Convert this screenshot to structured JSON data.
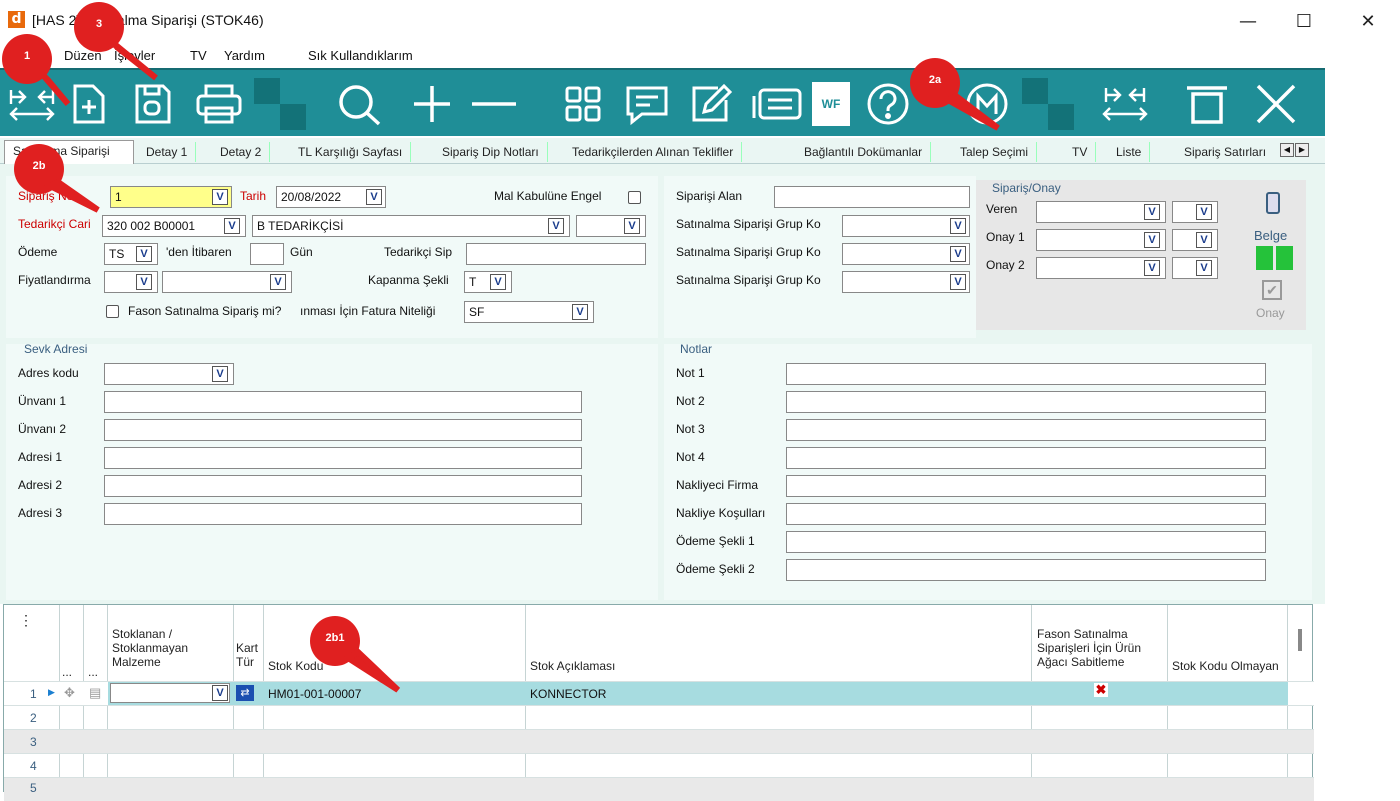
{
  "window": {
    "title": "[HAS         2] Satınalma Siparişi (STOK46)",
    "minimize": "—",
    "maximize": "☐",
    "close": "✕"
  },
  "menu": [
    "Düzen",
    "İşlevler",
    "TV",
    "Yardım",
    "Sık Kullandıklarım"
  ],
  "toolbar": {
    "wf_label": "WF",
    "icons": [
      "first-last-arrows-icon",
      "new-document-icon",
      "save-icon",
      "print-icon",
      "search-icon",
      "plus-icon",
      "minus-icon",
      "grid-icon",
      "comment-icon",
      "edit-icon",
      "list-icon",
      "wf-icon",
      "help-icon",
      "info-m-icon",
      "expand-icon",
      "delete-icon",
      "close-icon"
    ]
  },
  "tabs": [
    "Satınalma Siparişi",
    "Detay 1",
    "Detay 2",
    "TL Karşılığı Sayfası",
    "Sipariş Dip Notları",
    "Tedarikçilerden Alınan Teklifler",
    "Bağlantılı Dokümanlar",
    "Talep Seçimi",
    "TV",
    "Liste",
    "Sipariş Satırları"
  ],
  "form": {
    "siparis_no_label": "Sipariş No",
    "siparis_no_value": "1",
    "tarih_label": "Tarih",
    "tarih_value": "20/08/2022",
    "mal_kabul_label": "Mal Kabulüne Engel",
    "tedarikci_label": "Tedarikçi Cari",
    "tedarikci_code": "320 002 B00001",
    "tedarikci_name": "B TEDARİKÇİSİ",
    "odeme_label": "Ödeme",
    "odeme_value": "TS",
    "den_itibaren": "'den İtibaren",
    "gun": "Gün",
    "tedarikci_sip": "Tedarikçi Sip",
    "fiyatlandirma": "Fiyatlandırma",
    "kapanma_label": "Kapanma Şekli",
    "kapanma_value": "T",
    "fason_label": "Fason Satınalma Sipariş mi?",
    "fatura_niteligi_label": "ınması İçin Fatura Niteliği",
    "fatura_niteligi_value": "SF",
    "siparisi_alan": "Siparişi Alan",
    "grup_ko_1": "Satınalma Siparişi Grup Ko",
    "grup_ko_2": "Satınalma Siparişi Grup Ko",
    "grup_ko_3": "Satınalma Siparişi Grup Ko"
  },
  "onay": {
    "group_title": "Sipariş/Onay",
    "veren": "Veren",
    "onay1": "Onay 1",
    "onay2": "Onay 2",
    "belge": "Belge",
    "onay_btn": "Onay"
  },
  "sevk": {
    "group_title": "Sevk Adresi",
    "fields": [
      "Adres kodu",
      "Ünvanı 1",
      "Ünvanı 2",
      "Adresi 1",
      "Adresi 2",
      "Adresi 3"
    ]
  },
  "notlar": {
    "group_title": "Notlar",
    "fields": [
      "Not 1",
      "Not 2",
      "Not 3",
      "Not 4",
      "Nakliyeci Firma",
      "Nakliye Koşulları",
      "Ödeme Şekli 1",
      "Ödeme Şekli 2"
    ]
  },
  "grid": {
    "menu_dots": "⋮",
    "col_dots1": "...",
    "col_dots2": "...",
    "col_stoklanan": "Stoklanan / Stoklanmayan Malzeme",
    "col_kart_turu": "Kart Türü",
    "col_stok_kodu": "Stok Kodu",
    "col_stok_aciklama": "Stok Açıklaması",
    "col_fason": "Fason Satınalma Siparişleri İçin Ürün Ağacı Sabitleme",
    "col_olmayan": "Stok Kodu Olmayan",
    "rows": [
      {
        "num": "1",
        "stok_kodu": "HM01-001-00007",
        "aciklama": "KONNECTOR"
      },
      {
        "num": "2",
        "stok_kodu": "",
        "aciklama": ""
      },
      {
        "num": "3",
        "stok_kodu": "",
        "aciklama": ""
      },
      {
        "num": "4",
        "stok_kodu": "",
        "aciklama": ""
      },
      {
        "num": "5",
        "stok_kodu": "",
        "aciklama": ""
      }
    ],
    "fason_mark": "✖"
  },
  "annotations": [
    "1",
    "3",
    "2a",
    "2b",
    "2b1"
  ],
  "colors": {
    "toolbar": "#1f8e97",
    "form_bg": "#e9f6f2",
    "selected_row": "#a7dce0",
    "annotation": "#e02020"
  }
}
